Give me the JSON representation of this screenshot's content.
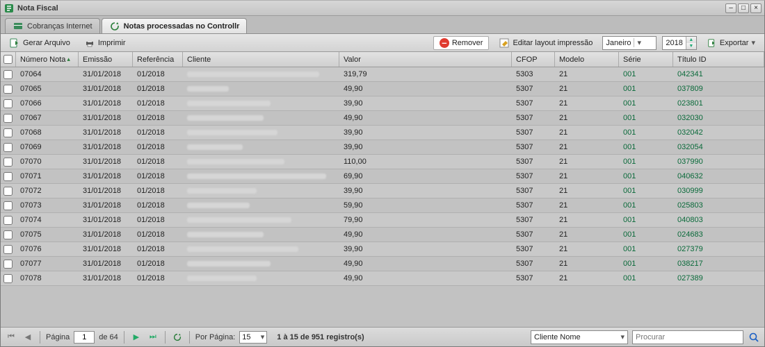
{
  "window": {
    "title": "Nota Fiscal"
  },
  "tabs": [
    {
      "label": "Cobranças Internet",
      "active": false,
      "icon": "billing-icon"
    },
    {
      "label": "Notas processadas no Controllr",
      "active": true,
      "icon": "refresh-icon"
    }
  ],
  "toolbar": {
    "gerar": "Gerar Arquivo",
    "imprimir": "Imprimir",
    "remover": "Remover",
    "editar_layout": "Editar layout impressão",
    "month": "Janeiro",
    "year": "2018",
    "exportar": "Exportar"
  },
  "columns": {
    "numero": "Número Nota",
    "emissao": "Emissão",
    "referencia": "Referência",
    "cliente": "Cliente",
    "valor": "Valor",
    "cfop": "CFOP",
    "modelo": "Modelo",
    "serie": "Série",
    "titulo": "Título ID"
  },
  "rows": [
    {
      "numero": "07064",
      "emissao": "31/01/2018",
      "referencia": "01/2018",
      "valor": "319,79",
      "cfop": "5303",
      "modelo": "21",
      "serie": "001",
      "titulo": "042341",
      "bw": 190
    },
    {
      "numero": "07065",
      "emissao": "31/01/2018",
      "referencia": "01/2018",
      "valor": "49,90",
      "cfop": "5307",
      "modelo": "21",
      "serie": "001",
      "titulo": "037809",
      "bw": 60
    },
    {
      "numero": "07066",
      "emissao": "31/01/2018",
      "referencia": "01/2018",
      "valor": "39,90",
      "cfop": "5307",
      "modelo": "21",
      "serie": "001",
      "titulo": "023801",
      "bw": 120
    },
    {
      "numero": "07067",
      "emissao": "31/01/2018",
      "referencia": "01/2018",
      "valor": "49,90",
      "cfop": "5307",
      "modelo": "21",
      "serie": "001",
      "titulo": "032030",
      "bw": 110
    },
    {
      "numero": "07068",
      "emissao": "31/01/2018",
      "referencia": "01/2018",
      "valor": "39,90",
      "cfop": "5307",
      "modelo": "21",
      "serie": "001",
      "titulo": "032042",
      "bw": 130
    },
    {
      "numero": "07069",
      "emissao": "31/01/2018",
      "referencia": "01/2018",
      "valor": "39,90",
      "cfop": "5307",
      "modelo": "21",
      "serie": "001",
      "titulo": "032054",
      "bw": 80
    },
    {
      "numero": "07070",
      "emissao": "31/01/2018",
      "referencia": "01/2018",
      "valor": "110,00",
      "cfop": "5307",
      "modelo": "21",
      "serie": "001",
      "titulo": "037990",
      "bw": 140
    },
    {
      "numero": "07071",
      "emissao": "31/01/2018",
      "referencia": "01/2018",
      "valor": "69,90",
      "cfop": "5307",
      "modelo": "21",
      "serie": "001",
      "titulo": "040632",
      "bw": 200
    },
    {
      "numero": "07072",
      "emissao": "31/01/2018",
      "referencia": "01/2018",
      "valor": "39,90",
      "cfop": "5307",
      "modelo": "21",
      "serie": "001",
      "titulo": "030999",
      "bw": 100
    },
    {
      "numero": "07073",
      "emissao": "31/01/2018",
      "referencia": "01/2018",
      "valor": "59,90",
      "cfop": "5307",
      "modelo": "21",
      "serie": "001",
      "titulo": "025803",
      "bw": 90
    },
    {
      "numero": "07074",
      "emissao": "31/01/2018",
      "referencia": "01/2018",
      "valor": "79,90",
      "cfop": "5307",
      "modelo": "21",
      "serie": "001",
      "titulo": "040803",
      "bw": 150
    },
    {
      "numero": "07075",
      "emissao": "31/01/2018",
      "referencia": "01/2018",
      "valor": "49,90",
      "cfop": "5307",
      "modelo": "21",
      "serie": "001",
      "titulo": "024683",
      "bw": 110
    },
    {
      "numero": "07076",
      "emissao": "31/01/2018",
      "referencia": "01/2018",
      "valor": "39,90",
      "cfop": "5307",
      "modelo": "21",
      "serie": "001",
      "titulo": "027379",
      "bw": 160
    },
    {
      "numero": "07077",
      "emissao": "31/01/2018",
      "referencia": "01/2018",
      "valor": "49,90",
      "cfop": "5307",
      "modelo": "21",
      "serie": "001",
      "titulo": "038217",
      "bw": 120
    },
    {
      "numero": "07078",
      "emissao": "31/01/2018",
      "referencia": "01/2018",
      "valor": "49,90",
      "cfop": "5307",
      "modelo": "21",
      "serie": "001",
      "titulo": "027389",
      "bw": 100
    }
  ],
  "pager": {
    "pagina_label": "Página",
    "pagina_value": "1",
    "de_label": "de 64",
    "porpagina_label": "Por Página:",
    "porpagina_value": "15",
    "summary": "1 à 15 de 951 registro(s)",
    "filter_field": "Cliente Nome",
    "search_placeholder": "Procurar"
  }
}
